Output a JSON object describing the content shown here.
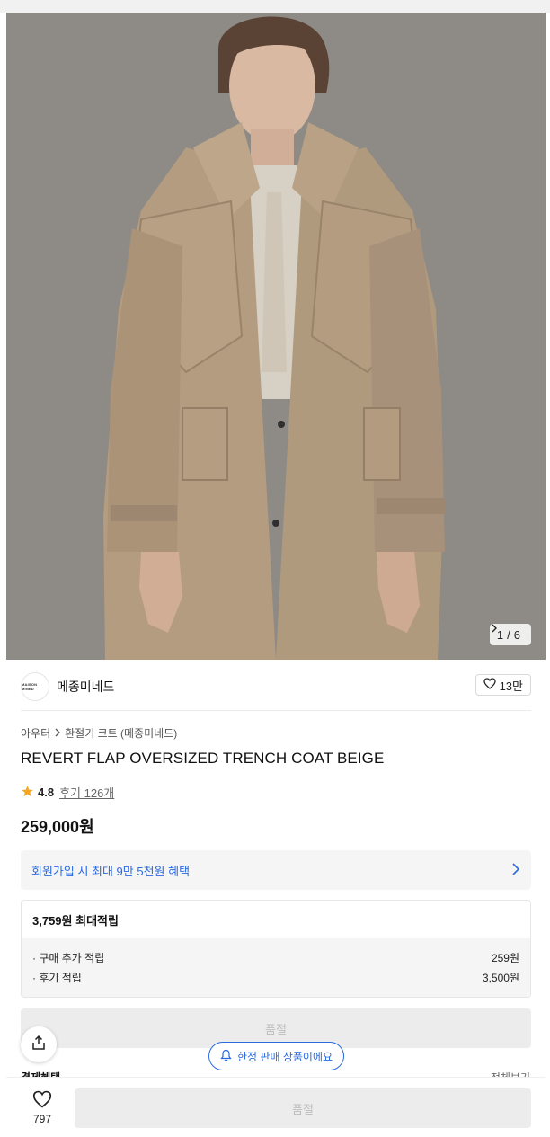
{
  "gallery": {
    "counter_current": "1",
    "counter_sep": "/",
    "counter_total": "6"
  },
  "brand": {
    "logo_text": "MAISON MINED",
    "name": "메종미네드",
    "like_count": "13만"
  },
  "breadcrumb": {
    "category": "아우터",
    "subcategory": "환절기 코트 (메종미네드)"
  },
  "product": {
    "title": "REVERT FLAP OVERSIZED TRENCH COAT BEIGE",
    "rating": "4.8",
    "reviews": "후기 126개",
    "price": "259,000원"
  },
  "benefit": {
    "text": "회원가입 시 최대 9만 5천원 혜택"
  },
  "points": {
    "header": "3,759원 최대적립",
    "rows": [
      {
        "label": "· 구매 추가 적립",
        "value": "259원"
      },
      {
        "label": "· 후기 적립",
        "value": "3,500원"
      }
    ]
  },
  "soldout_label": "품절",
  "limited_badge": "한정 판매 상품이에요",
  "partial": {
    "left": "결제혜택",
    "right": "전체보기"
  },
  "bottom": {
    "like_count": "797",
    "soldout_label": "품절"
  },
  "colors": {
    "accent_blue": "#2a6ae0",
    "star": "#f5a623",
    "soldout_bg": "#ececec",
    "coat": "#b39c80"
  }
}
